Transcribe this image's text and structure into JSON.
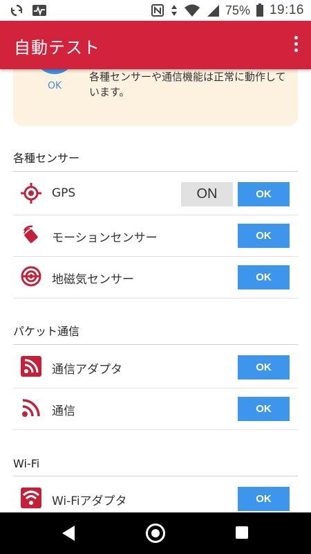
{
  "status_bar": {
    "battery": "75%",
    "time": "19:16",
    "icons": [
      "sync-icon",
      "activity-icon",
      "nfc-icon",
      "data-arrows-icon",
      "wifi-icon",
      "signal-icon",
      "battery-icon"
    ]
  },
  "app_bar": {
    "title": "自動テスト",
    "menu_icon": "more-vert-icon"
  },
  "summary": {
    "status": "OK",
    "message": "各種センサーや通信機能は正常に動作しています。"
  },
  "sections": [
    {
      "title": "各種センサー",
      "rows": [
        {
          "label": "GPS",
          "icon": "gps-target-icon",
          "toggle": "ON",
          "result": "OK"
        },
        {
          "label": "モーションセンサー",
          "icon": "motion-sensor-icon",
          "result": "OK"
        },
        {
          "label": "地磁気センサー",
          "icon": "geomagnetic-icon",
          "result": "OK"
        }
      ]
    },
    {
      "title": "パケット通信",
      "rows": [
        {
          "label": "通信アダプタ",
          "icon": "packet-adapter-icon",
          "result": "OK"
        },
        {
          "label": "通信",
          "icon": "packet-signal-icon",
          "result": "OK"
        }
      ]
    },
    {
      "title": "Wi-Fi",
      "rows": [
        {
          "label": "Wi-Fiアダプタ",
          "icon": "wifi-adapter-icon",
          "result": "OK"
        }
      ]
    }
  ],
  "colors": {
    "app_bar": "#d2233c",
    "ok_button": "#3d96ec",
    "summary_bg": "#fdf1df",
    "icon_red": "#c4203a"
  },
  "nav_bar": {
    "buttons": [
      "back-icon",
      "home-icon",
      "recents-icon"
    ]
  }
}
